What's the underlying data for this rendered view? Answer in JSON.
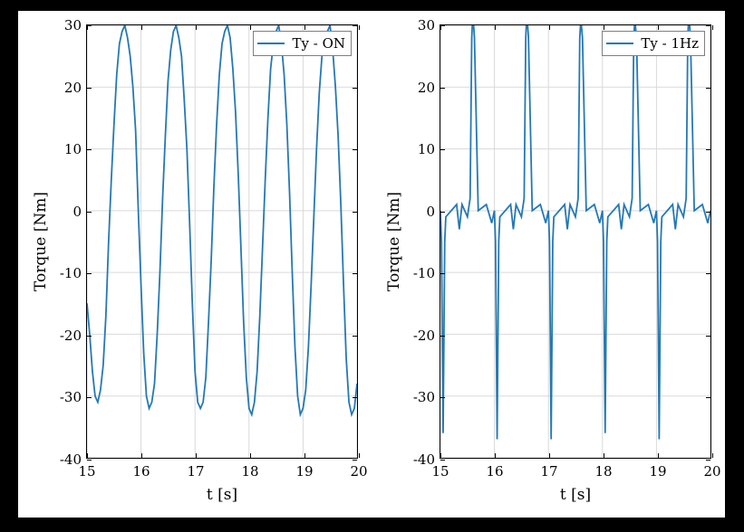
{
  "chart_data": [
    {
      "type": "line",
      "title": "",
      "xlabel": "t [s]",
      "ylabel": "Torque [Nm]",
      "xlim": [
        15,
        20
      ],
      "ylim": [
        -40,
        30
      ],
      "xticks": [
        15,
        16,
        17,
        18,
        19,
        20
      ],
      "yticks": [
        -40,
        -30,
        -20,
        -10,
        0,
        10,
        20,
        30
      ],
      "legend": "Ty - ON",
      "color": "#2478b5",
      "series": [
        {
          "name": "Ty - ON",
          "x": [
            15.0,
            15.05,
            15.1,
            15.15,
            15.2,
            15.25,
            15.3,
            15.35,
            15.4,
            15.45,
            15.5,
            15.55,
            15.6,
            15.65,
            15.7,
            15.75,
            15.8,
            15.85,
            15.9,
            15.95,
            16.0,
            16.05,
            16.1,
            16.15,
            16.2,
            16.25,
            16.3,
            16.35,
            16.4,
            16.45,
            16.5,
            16.55,
            16.6,
            16.65,
            16.7,
            16.75,
            16.8,
            16.85,
            16.9,
            16.95,
            17.0,
            17.05,
            17.1,
            17.15,
            17.2,
            17.25,
            17.3,
            17.35,
            17.4,
            17.45,
            17.5,
            17.55,
            17.6,
            17.65,
            17.7,
            17.75,
            17.8,
            17.85,
            17.9,
            17.95,
            18.0,
            18.05,
            18.1,
            18.15,
            18.2,
            18.25,
            18.3,
            18.35,
            18.4,
            18.45,
            18.5,
            18.55,
            18.6,
            18.65,
            18.7,
            18.75,
            18.8,
            18.85,
            18.9,
            18.95,
            19.0,
            19.05,
            19.1,
            19.15,
            19.2,
            19.25,
            19.3,
            19.35,
            19.4,
            19.45,
            19.5,
            19.55,
            19.6,
            19.65,
            19.7,
            19.75,
            19.8,
            19.85,
            19.9,
            19.95,
            20.0
          ],
          "y": [
            -15,
            -20,
            -26,
            -30,
            -31,
            -29,
            -25,
            -17,
            -5,
            5,
            14,
            22,
            27,
            29,
            30,
            28,
            25,
            20,
            13,
            0,
            -12,
            -23,
            -30,
            -32,
            -31,
            -28,
            -20,
            -10,
            2,
            12,
            21,
            26,
            29,
            30,
            28,
            25,
            18,
            10,
            -2,
            -15,
            -26,
            -31,
            -32,
            -31,
            -27,
            -18,
            -8,
            4,
            14,
            22,
            27,
            29,
            30,
            28,
            23,
            16,
            6,
            -6,
            -18,
            -27,
            -32,
            -33,
            -31,
            -26,
            -17,
            -6,
            5,
            15,
            23,
            27,
            29,
            30,
            27,
            22,
            14,
            3,
            -10,
            -22,
            -30,
            -33,
            -32,
            -29,
            -22,
            -12,
            -1,
            10,
            19,
            25,
            28,
            29,
            30,
            26,
            20,
            12,
            1,
            -12,
            -24,
            -31,
            -33,
            -32,
            -28
          ]
        }
      ]
    },
    {
      "type": "line",
      "title": "",
      "xlabel": "t [s]",
      "ylabel": "Torque [Nm]",
      "xlim": [
        15,
        20
      ],
      "ylim": [
        -40,
        30
      ],
      "xticks": [
        15,
        16,
        17,
        18,
        19,
        20
      ],
      "yticks": [
        -40,
        -30,
        -20,
        -10,
        0,
        10,
        20,
        30
      ],
      "legend": "Ty - 1Hz",
      "color": "#2478b5",
      "series": [
        {
          "name": "Ty - 1Hz",
          "x": [
            15.0,
            15.02,
            15.05,
            15.08,
            15.1,
            15.3,
            15.35,
            15.4,
            15.5,
            15.55,
            15.58,
            15.6,
            15.63,
            15.7,
            15.85,
            15.95,
            16.0,
            16.02,
            16.05,
            16.08,
            16.1,
            16.3,
            16.35,
            16.4,
            16.5,
            16.55,
            16.58,
            16.6,
            16.63,
            16.7,
            16.85,
            16.95,
            17.0,
            17.02,
            17.05,
            17.08,
            17.1,
            17.3,
            17.35,
            17.4,
            17.5,
            17.55,
            17.58,
            17.6,
            17.63,
            17.7,
            17.85,
            17.95,
            18.0,
            18.02,
            18.05,
            18.08,
            18.1,
            18.3,
            18.35,
            18.4,
            18.5,
            18.55,
            18.58,
            18.6,
            18.63,
            18.7,
            18.85,
            18.95,
            19.0,
            19.02,
            19.05,
            19.08,
            19.1,
            19.3,
            19.35,
            19.4,
            19.5,
            19.55,
            19.58,
            19.6,
            19.63,
            19.7,
            19.85,
            19.95,
            20.0
          ],
          "y": [
            0,
            -5,
            -36,
            -5,
            -1,
            1,
            -3,
            1,
            -1,
            2,
            28,
            32,
            28,
            0,
            1,
            -2,
            0,
            -5,
            -37,
            -5,
            -1,
            1,
            -3,
            1,
            -1,
            2,
            28,
            32,
            28,
            0,
            1,
            -2,
            0,
            -5,
            -37,
            -5,
            -1,
            1,
            -3,
            1,
            -1,
            2,
            28,
            31,
            28,
            0,
            1,
            -2,
            0,
            -5,
            -36,
            -5,
            -1,
            1,
            -3,
            1,
            -1,
            2,
            28,
            31,
            28,
            0,
            1,
            -2,
            0,
            -5,
            -37,
            -5,
            -1,
            1,
            -3,
            1,
            -1,
            2,
            28,
            32,
            28,
            0,
            1,
            -2,
            0
          ]
        }
      ]
    }
  ]
}
